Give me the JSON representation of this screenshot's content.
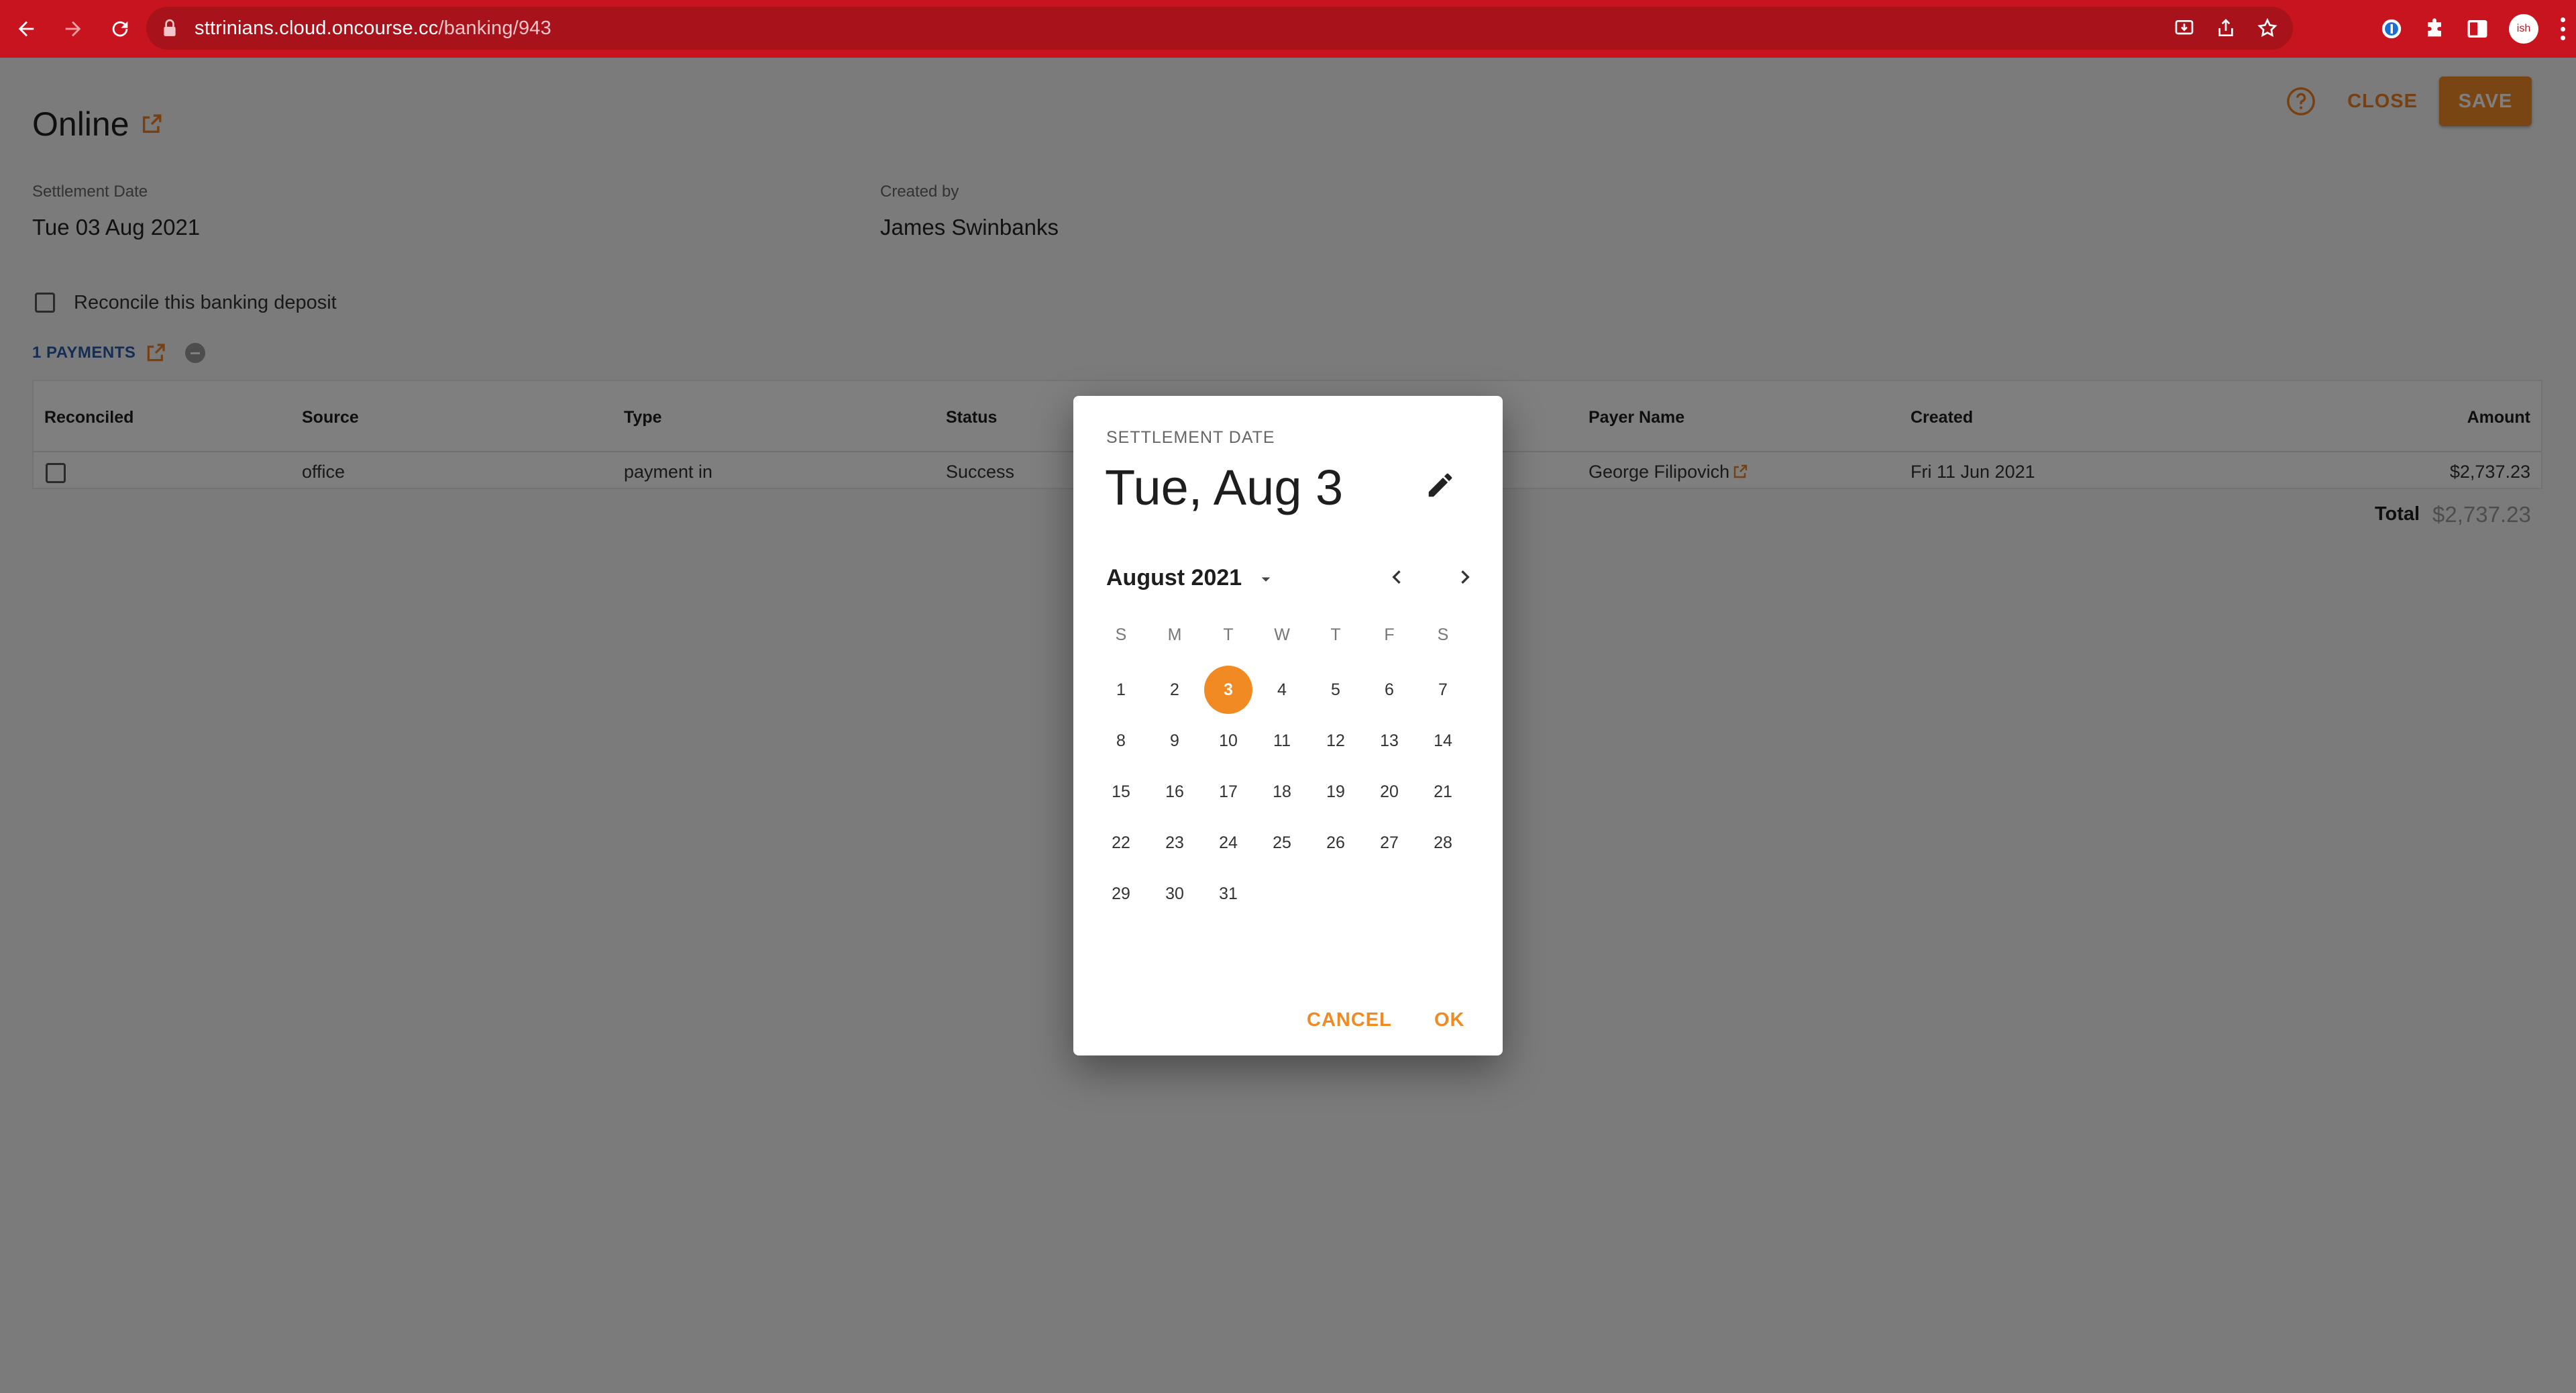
{
  "browser": {
    "url_host": "sttrinians.cloud.oncourse.cc",
    "url_path": "/banking/943",
    "avatar_text": "ish"
  },
  "header": {
    "title": "Online",
    "close_label": "CLOSE",
    "save_label": "SAVE"
  },
  "fields": {
    "settlement_date_label": "Settlement Date",
    "settlement_date_value": "Tue 03 Aug 2021",
    "created_by_label": "Created by",
    "created_by_value": "James Swinbanks"
  },
  "reconcile_label": "Reconcile this banking deposit",
  "payments": {
    "link_label": "1 PAYMENTS",
    "columns": [
      "Reconciled",
      "Source",
      "Type",
      "Status",
      "Payer Name",
      "Created",
      "Amount"
    ],
    "rows": [
      {
        "source": "office",
        "type": "payment in",
        "status": "Success",
        "payer_name": "George Filipovich",
        "created": "Fri 11 Jun 2021",
        "amount": "$2,737.23"
      }
    ],
    "total_label": "Total",
    "total_value": "$2,737.23"
  },
  "dialog": {
    "title": "SETTLEMENT DATE",
    "selected_date": "Tue, Aug 3",
    "month_label": "August 2021",
    "weekdays": [
      "S",
      "M",
      "T",
      "W",
      "T",
      "F",
      "S"
    ],
    "weeks": [
      [
        "1",
        "2",
        "3",
        "4",
        "5",
        "6",
        "7"
      ],
      [
        "8",
        "9",
        "10",
        "11",
        "12",
        "13",
        "14"
      ],
      [
        "15",
        "16",
        "17",
        "18",
        "19",
        "20",
        "21"
      ],
      [
        "22",
        "23",
        "24",
        "25",
        "26",
        "27",
        "28"
      ],
      [
        "29",
        "30",
        "31",
        "",
        "",
        "",
        ""
      ]
    ],
    "selected_day": "3",
    "cancel_label": "CANCEL",
    "ok_label": "OK"
  },
  "colors": {
    "accent": "#f28a24",
    "browser_bar": "#c8141e",
    "link": "#2b5aa7"
  }
}
